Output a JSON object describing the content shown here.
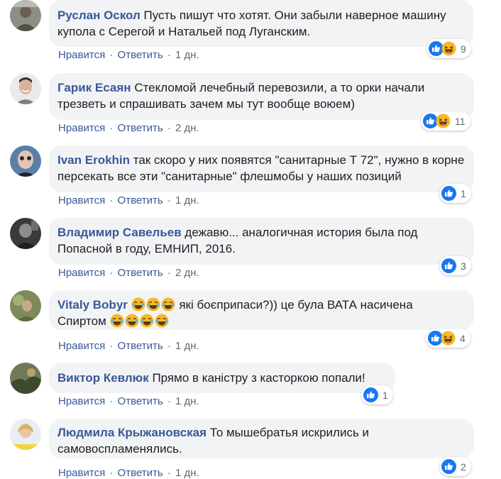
{
  "actions": {
    "like": "Нравится",
    "reply": "Ответить",
    "sep": "·"
  },
  "colors": {
    "author": "#385898",
    "bubble": "#f2f3f5",
    "meta": "#606770",
    "like": "#1877f2",
    "haha": "#f7b928"
  },
  "comments": [
    {
      "author": "Руслан Оскол",
      "text": "Пусть пишут что хотят. Они забыли наверное машину купола с Серегой и Натальей под Луганским.",
      "age": "1 дн.",
      "reactions": [
        "like-icon",
        "haha-icon"
      ],
      "count": "9"
    },
    {
      "author": "Гарик Есаян",
      "text": "Стекломой лечебный перевозили, а то орки начали трезветь и спрашивать зачем мы тут вообще воюем)",
      "age": "2 дн.",
      "reactions": [
        "like-icon",
        "haha-icon"
      ],
      "count": "11"
    },
    {
      "author": "Ivan Erokhin",
      "text": "так скоро у них появятся \"санитарные Т 72\", нужно в корне персекать все эти \"санитарные\" флешмобы у наших позиций",
      "age": "1 дн.",
      "reactions": [
        "like-icon"
      ],
      "count": "1"
    },
    {
      "author": "Владимир Савельев",
      "text": "дежавю... аналогичная история была под Попасной в году, ЕМНИП, 2016.",
      "age": "2 дн.",
      "reactions": [
        "like-icon"
      ],
      "count": "3"
    },
    {
      "author": "Vitaly Bobyr",
      "text_before": "які боєприпаси?)) це була ВАТА насичена Спиртом",
      "age": "1 дн.",
      "reactions": [
        "like-icon",
        "haha-icon"
      ],
      "count": "4",
      "emoji": "laughing-tears-emoji"
    },
    {
      "author": "Виктор Кевлюк",
      "text": "Прямо в каністру з касторкою попали!",
      "age": "1 дн.",
      "reactions": [
        "like-icon"
      ],
      "count": "1"
    },
    {
      "author": "Людмила Крыжановская",
      "text": "То мышебратья искрились и самовоспламенялись.",
      "age": "1 дн.",
      "reactions": [
        "like-icon"
      ],
      "count": "2"
    }
  ]
}
